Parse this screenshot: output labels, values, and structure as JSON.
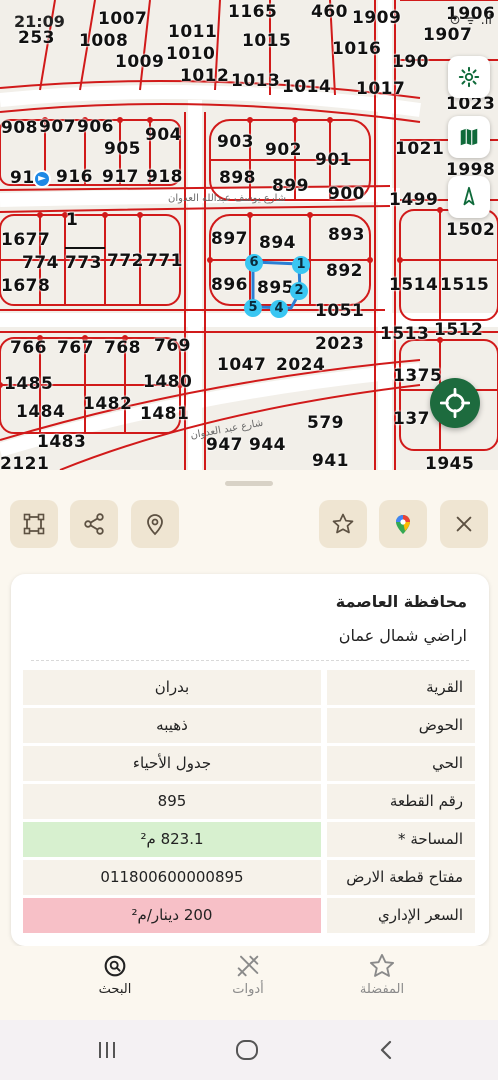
{
  "status": {
    "time": "21:09",
    "icons": "⊙ ᯤ .ıl"
  },
  "map": {
    "plots": [
      "253",
      "1007",
      "1008",
      "1009",
      "1010",
      "1011",
      "1012",
      "1013",
      "1014",
      "1015",
      "1016",
      "1017",
      "1165",
      "460",
      "1909",
      "1906",
      "1907",
      "1907b",
      "1023",
      "908",
      "907",
      "906",
      "904",
      "905",
      "903",
      "902",
      "901",
      "1021",
      "1998",
      "910",
      "916",
      "917",
      "918",
      "898",
      "899",
      "900",
      "1499",
      "1502",
      "893",
      "897",
      "894",
      "1",
      "1677",
      "774",
      "773",
      "772",
      "771",
      "896",
      "895",
      "892",
      "1051",
      "1678",
      "1514",
      "1515",
      "1513",
      "1512",
      "766",
      "767",
      "768",
      "769",
      "1047",
      "2024",
      "2023",
      "1485",
      "1480",
      "1375",
      "1484",
      "1482",
      "1481",
      "579",
      "1483",
      "947",
      "944",
      "941",
      "2121",
      "1945",
      "137"
    ],
    "plot_text": {
      "253": "253",
      "1007": "1007",
      "1008": "1008",
      "1009": "1009",
      "1010": "1010",
      "1011": "1011",
      "1012": "1012",
      "1013": "1013",
      "1014": "1014",
      "1015": "1015",
      "1016": "1016",
      "1017": "1017",
      "1165": "1165",
      "460": "460",
      "1909": "1909",
      "1906": "1906",
      "1907": "1907",
      "1907b": "190",
      "1023": "1023",
      "908": "908",
      "907": "907",
      "906": "906",
      "904": "904",
      "905": "905",
      "903": "903",
      "902": "902",
      "901": "901",
      "1021": "1021",
      "1998": "1998",
      "910": "91",
      "916": "916",
      "917": "917",
      "918": "918",
      "898": "898",
      "899": "899",
      "900": "900",
      "1499": "1499",
      "1502": "1502",
      "893": "893",
      "897": "897",
      "894": "894",
      "1": "1",
      "1677": "1677",
      "774": "774",
      "773": "773",
      "772": "772",
      "771": "771",
      "896": "896",
      "895": "895",
      "892": "892",
      "1051": "1051",
      "1678": "1678",
      "1514": "1514",
      "1515": "1515",
      "1513": "1513",
      "1512": "1512",
      "766": "766",
      "767": "767",
      "768": "768",
      "769": "769",
      "1047": "1047",
      "2024": "2024",
      "2023": "2023",
      "1485": "1485",
      "1480": "1480",
      "1375": "1375",
      "1484": "1484",
      "1482": "1482",
      "1481": "1481",
      "579": "579",
      "1483": "1483",
      "947": "947",
      "944": "944",
      "941": "941",
      "2121": "2121",
      "1945": "1945",
      "137": "137"
    },
    "selected_vertices": [
      "1",
      "2",
      "4",
      "3",
      "5",
      "6"
    ],
    "street_name": "شارع يوسف عبدالله العدوان",
    "street_name_2": "شارع عبد العدوان"
  },
  "toolbar": {
    "buttons": [
      "polygon-icon",
      "share-icon",
      "location-pin-icon",
      "star-icon",
      "google-maps-icon",
      "close-icon"
    ]
  },
  "details": {
    "governorate": "محافظة العاصمة",
    "lands": "اراضي شمال عمان",
    "rows": [
      {
        "label": "القرية",
        "value": "بدران"
      },
      {
        "label": "الحوض",
        "value": "ذهيبه"
      },
      {
        "label": "الحي",
        "value": "جدول الأحياء"
      },
      {
        "label": "رقم القطعة",
        "value": "895"
      },
      {
        "label": "المساحة *",
        "value": "823.1 م²"
      },
      {
        "label": "مفتاح قطعة الارض",
        "value": "011800600000895"
      },
      {
        "label": "السعر الإداري",
        "value": "200 دينار/م²"
      }
    ]
  },
  "bottom_nav": {
    "search": "البحث",
    "tools": "أدوات",
    "favorites": "المفضلة"
  },
  "colors": {
    "accent": "#1d6b3e",
    "parcel_line": "#d11a1a",
    "selection": "#39c6f2"
  }
}
